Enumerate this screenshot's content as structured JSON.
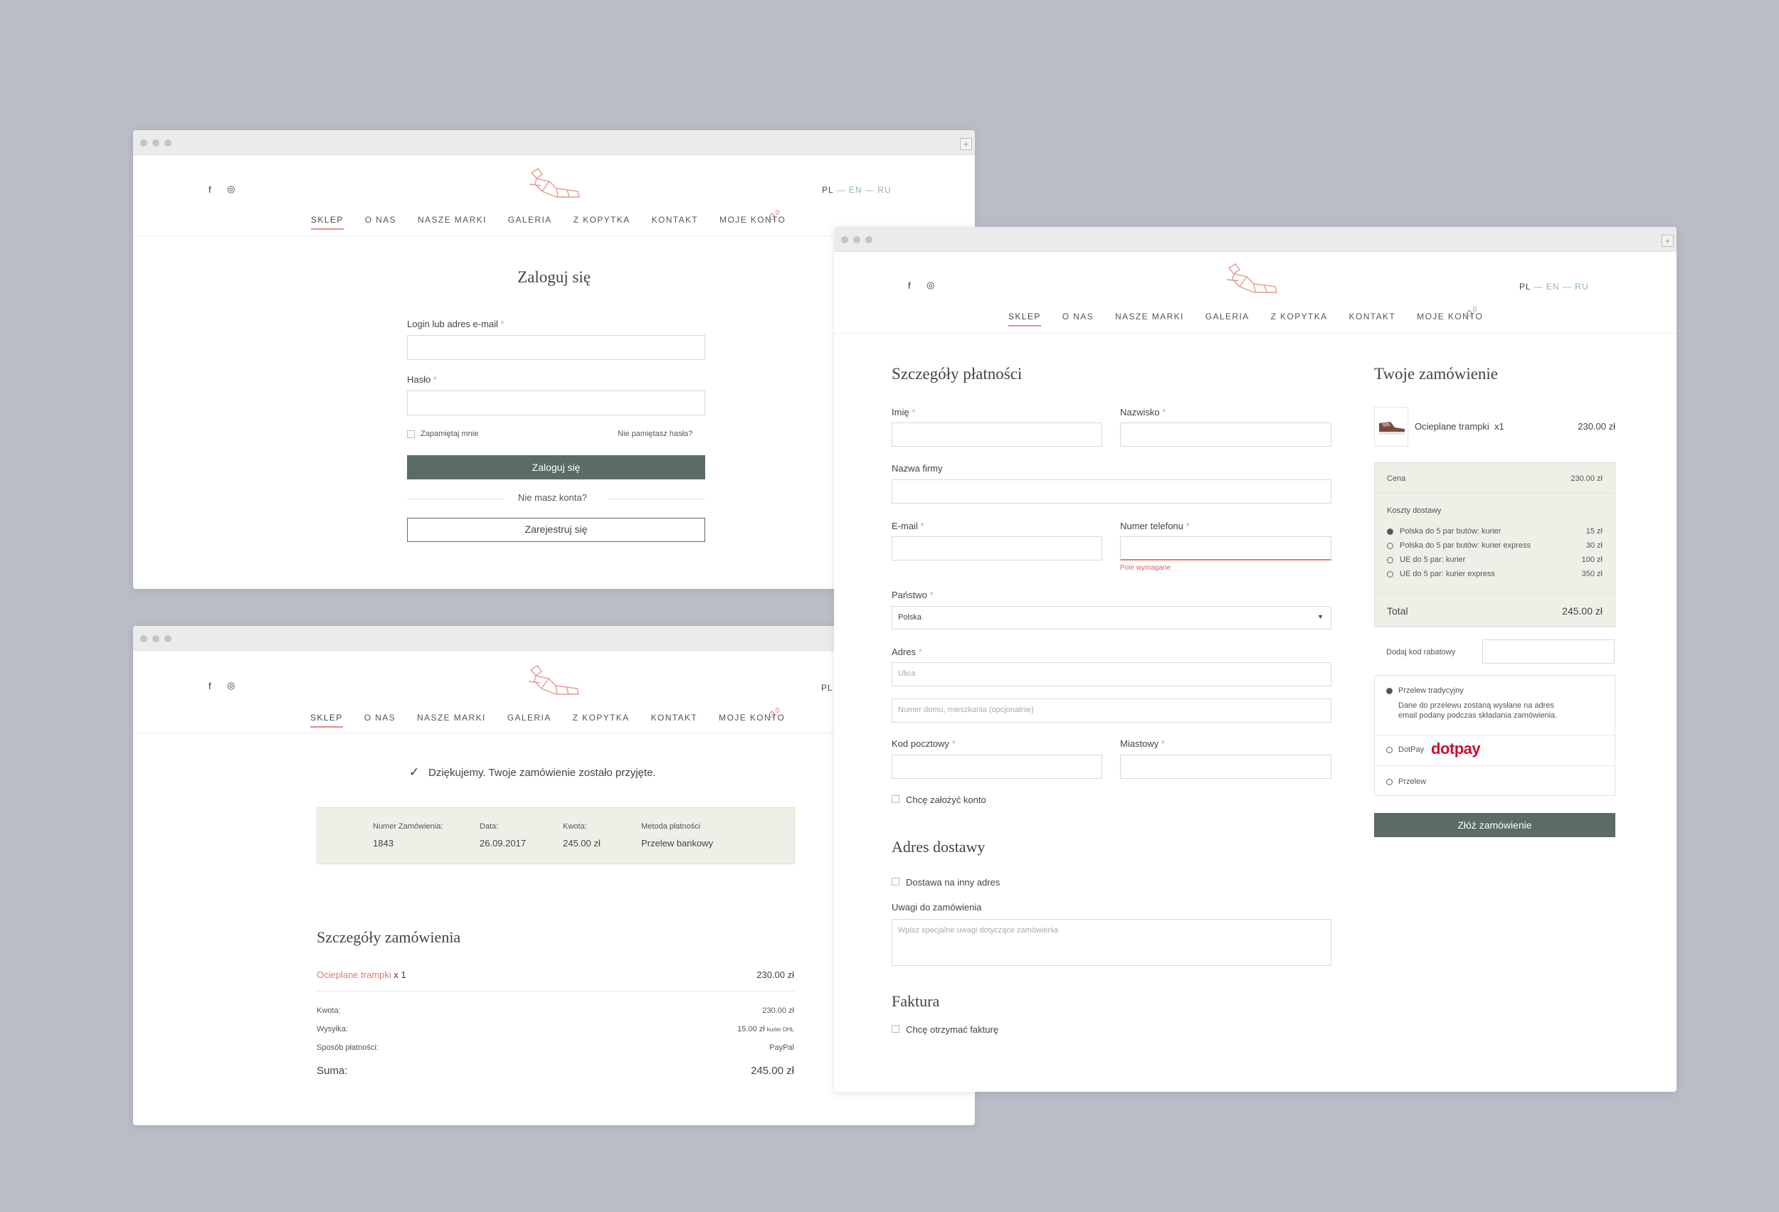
{
  "header": {
    "social": [
      "f",
      "◎"
    ],
    "lang": {
      "pl": "PL",
      "en": "EN",
      "ru": "RU",
      "sep": "—"
    },
    "nav": [
      "SKLEP",
      "O NAS",
      "NASZE MARKI",
      "GALERIA",
      "Z KOPYTKA",
      "KONTAKT",
      "MOJE KONTO"
    ],
    "cart_count": "0"
  },
  "login": {
    "title": "Zaloguj się",
    "login_label": "Login lub adres e-mail",
    "password_label": "Hasło",
    "remember": "Zapamiętaj mnie",
    "forgot": "Nie pamiętasz hasła?",
    "submit": "Zaloguj się",
    "no_account": "Nie masz konta?",
    "register": "Zarejestruj się"
  },
  "confirmation": {
    "lang_pl": "PL",
    "thanks": "Dziękujemy. Twoje zamówienie zostało przyjęte.",
    "summary": [
      {
        "label": "Numer Zamówienia:",
        "value": "1843"
      },
      {
        "label": "Data:",
        "value": "26.09.2017"
      },
      {
        "label": "Kwota:",
        "value": "245.00 zł"
      },
      {
        "label": "Metoda płatności",
        "value": "Przelew bankowy"
      }
    ],
    "details_title": "Szczegóły zamówienia",
    "product_name": "Ocieplane trampki",
    "product_qty": " x 1",
    "product_price": "230.00 zł",
    "rows": [
      {
        "label": "Kwota:",
        "value": "230.00 zł",
        "note": ""
      },
      {
        "label": "Wysyłka:",
        "value": "15.00 zł",
        "note": "kurier DHL"
      },
      {
        "label": "Sposób płatności:",
        "value": "PayPal",
        "note": ""
      }
    ],
    "total_label": "Suma:",
    "total_value": "245.00 zł"
  },
  "checkout": {
    "billing_title": "Szczegóły płatności",
    "first_name": "Imię",
    "last_name": "Nazwisko",
    "company": "Nazwa firmy",
    "email": "E-mail",
    "phone": "Numer telefonu",
    "phone_error": "Pole wymagane",
    "country_label": "Państwo",
    "country_value": "Polska",
    "address_label": "Adres",
    "street_placeholder": "Ulica",
    "house_placeholder": "Numer domu, mieszkania (opcjonalnie)",
    "postcode": "Kod pocztowy",
    "city": "Miastowy",
    "create_account": "Chcę założyć konto",
    "shipping_title": "Adres dostawy",
    "ship_other": "Dostawa na inny adres",
    "notes_label": "Uwagi do zamówienia",
    "notes_placeholder": "Wpisz specjalne uwagi dotyczące zamówienia",
    "invoice_title": "Faktura",
    "invoice_check": "Chcę otrzymać fakturę",
    "order_title": "Twoje zamówienie",
    "item_name": "Ocieplane trampki",
    "item_qty": "x1",
    "item_price": "230.00 zł",
    "price_label": "Cena",
    "price_value": "230.00 zł",
    "shipping_costs": "Koszty dostawy",
    "shipping_options": [
      {
        "label": "Polska do 5 par butów: kurier",
        "price": "15 zł",
        "selected": true
      },
      {
        "label": "Polska do 5 par butów: kurier express",
        "price": "30 zł",
        "selected": false
      },
      {
        "label": "UE do 5 par: kurier",
        "price": "100 zł",
        "selected": false
      },
      {
        "label": "UE do 5 par: kurier express",
        "price": "350 zł",
        "selected": false
      }
    ],
    "total_label": "Total",
    "total_value": "245.00 zł",
    "coupon_label": "Dodaj kod rabatowy",
    "pay_transfer": "Przelew tradycyjny",
    "pay_transfer_desc1": "Dane do przelewu zostaną wysłane na adres",
    "pay_transfer_desc2": "email podany podczas składania zamówienia.",
    "pay_dotpay": "DotPay",
    "dotpay_logo": "dotpay",
    "pay_przelew": "Przelew",
    "place_order": "Złóż zamówienie"
  },
  "colors": {
    "accent": "#e38e84",
    "dark_button": "#5b6b65",
    "panel": "#eef0e8",
    "link": "#e07a70"
  }
}
